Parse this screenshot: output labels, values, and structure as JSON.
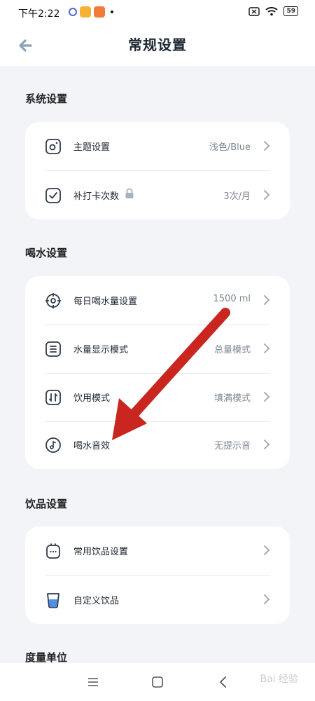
{
  "status": {
    "time": "下午2:22",
    "battery": "59"
  },
  "header": {
    "title": "常规设置"
  },
  "sections": [
    {
      "title": "系统设置",
      "items": [
        {
          "label": "主题设置",
          "value": "浅色/Blue",
          "icon": "palette-icon"
        },
        {
          "label": "补打卡次数",
          "value": "3次/月",
          "icon": "checkbox-icon",
          "locked": true
        }
      ]
    },
    {
      "title": "喝水设置",
      "items": [
        {
          "label": "每日喝水量设置",
          "value": "1500 ml",
          "icon": "target-icon"
        },
        {
          "label": "水量显示模式",
          "value": "总量模式",
          "icon": "list-icon"
        },
        {
          "label": "饮用模式",
          "value": "填满模式",
          "icon": "swap-icon"
        },
        {
          "label": "喝水音效",
          "value": "无提示音",
          "icon": "music-icon"
        }
      ]
    },
    {
      "title": "饮品设置",
      "items": [
        {
          "label": "常用饮品设置",
          "value": "",
          "icon": "drink-box-icon"
        },
        {
          "label": "自定义饮品",
          "value": "",
          "icon": "cup-icon"
        }
      ]
    },
    {
      "title": "度量单位",
      "items": []
    }
  ],
  "nav": {
    "watermark": "Bai 经验"
  },
  "colors": {
    "accent": "#2f3a4a",
    "arrow": "#c8261e",
    "cup": "#4f8fe6"
  }
}
